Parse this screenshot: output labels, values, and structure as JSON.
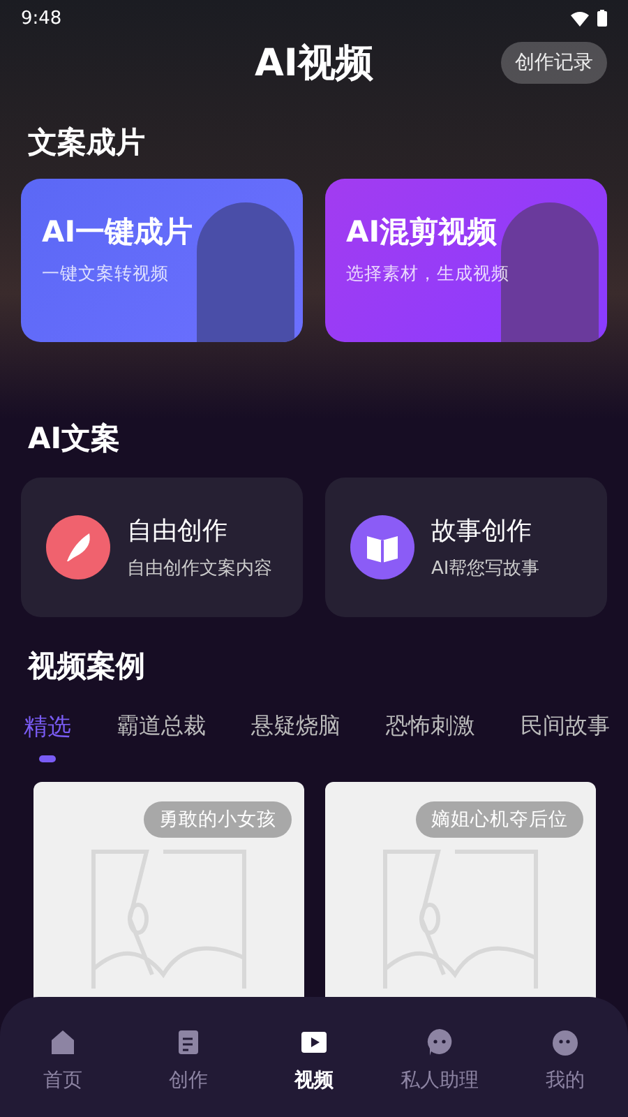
{
  "status_bar": {
    "time": "9:48"
  },
  "header": {
    "title": "AI视频",
    "history_button": "创作记录"
  },
  "sections": [
    {
      "title": "文案成片"
    },
    {
      "title": "AI文案"
    },
    {
      "title": "视频案例"
    }
  ],
  "feature_cards": [
    {
      "title": "AI一键成片",
      "subtitle": "一键文案转视频",
      "kind": "blue"
    },
    {
      "title": "AI混剪视频",
      "subtitle": "选择素材，生成视频",
      "kind": "purple"
    }
  ],
  "writing_cards": [
    {
      "title": "自由创作",
      "subtitle": "自由创作文案内容",
      "kind": "feather"
    },
    {
      "title": "故事创作",
      "subtitle": "AI帮您写故事",
      "kind": "book"
    }
  ],
  "case_tabs": [
    {
      "label": "精选",
      "selected": true
    },
    {
      "label": "霸道总裁",
      "selected": false
    },
    {
      "label": "悬疑烧脑",
      "selected": false
    },
    {
      "label": "恐怖刺激",
      "selected": false
    },
    {
      "label": "民间故事",
      "selected": false
    }
  ],
  "cases": [
    {
      "tag": "勇敢的小女孩"
    },
    {
      "tag": "嫡姐心机夺后位"
    }
  ],
  "bottom_nav": [
    {
      "label": "首页",
      "kind": "home",
      "selected": false
    },
    {
      "label": "创作",
      "kind": "edit",
      "selected": false
    },
    {
      "label": "视频",
      "kind": "play",
      "selected": true
    },
    {
      "label": "私人助理",
      "kind": "chat",
      "selected": false
    },
    {
      "label": "我的",
      "kind": "face",
      "selected": false
    }
  ]
}
